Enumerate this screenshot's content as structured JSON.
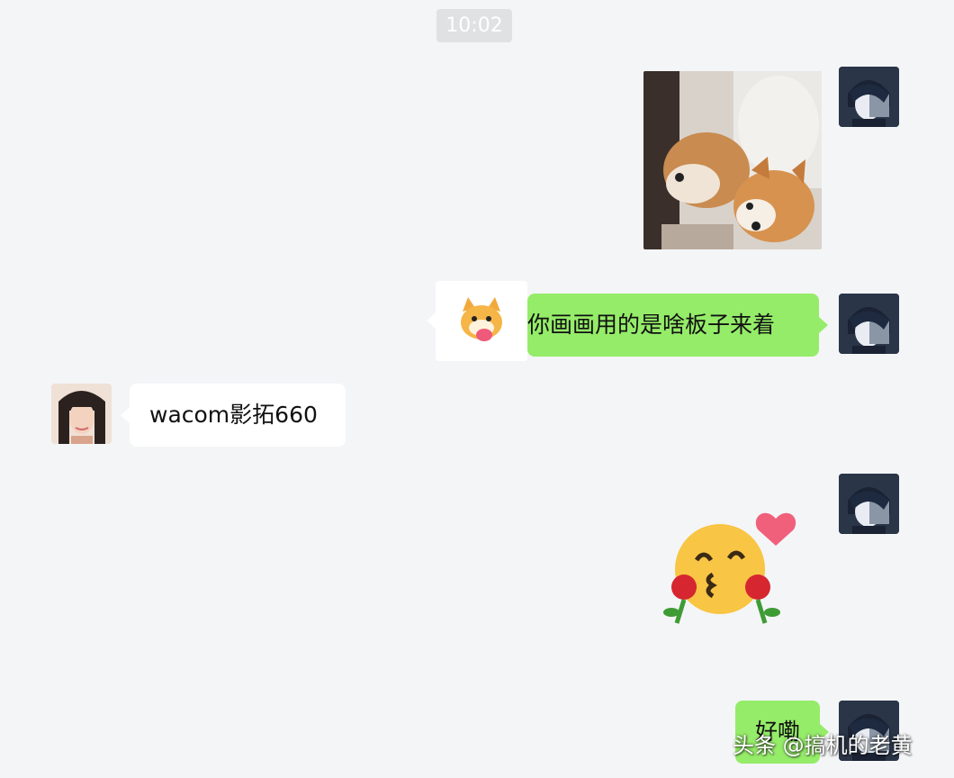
{
  "chat": {
    "timestamp": "10:02",
    "messages": [
      {
        "sender": "me",
        "type": "image",
        "content": "dog photo"
      },
      {
        "sender": "me",
        "type": "text",
        "text": "你画画用的是啥板子来着"
      },
      {
        "sender": "friend",
        "type": "text",
        "text": "wacom影拓660"
      },
      {
        "sender": "me",
        "type": "sticker",
        "content": "kissing emoji with roses"
      },
      {
        "sender": "me",
        "type": "text",
        "text": "好嘞"
      }
    ]
  },
  "watermark": "头条 @搞机的老黄",
  "colors": {
    "background": "#f4f5f7",
    "my_bubble": "#95ec69",
    "friend_bubble": "#ffffff",
    "timestamp_bg": "#e0e1e3"
  }
}
